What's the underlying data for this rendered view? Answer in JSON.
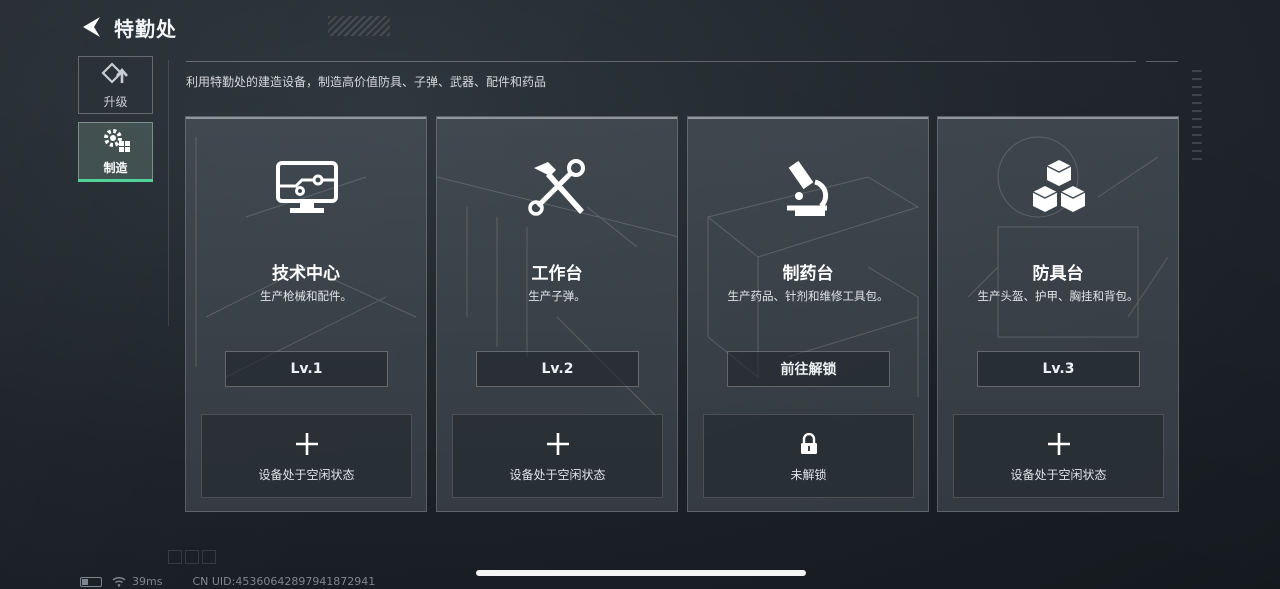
{
  "header": {
    "title": "特勤处"
  },
  "subtitle": "利用特勤处的建造设备，制造高价值防具、子弹、武器、配件和药品",
  "sidebar": {
    "tabs": [
      {
        "label": "升级",
        "icon": "upgrade-icon"
      },
      {
        "label": "制造",
        "icon": "gears-icon",
        "active": true
      }
    ]
  },
  "cards": [
    {
      "name": "技术中心",
      "desc": "生产枪械和配件。",
      "button": "Lv.1",
      "slot": "设备处于空闲状态",
      "icon": "monitor-circuit-icon",
      "slot_icon": "plus-icon"
    },
    {
      "name": "工作台",
      "desc": "生产子弹。",
      "button": "Lv.2",
      "slot": "设备处于空闲状态",
      "icon": "hammer-wrench-icon",
      "slot_icon": "plus-icon"
    },
    {
      "name": "制药台",
      "desc": "生产药品、针剂和维修工具包。",
      "button": "前往解锁",
      "slot": "未解锁",
      "icon": "microscope-icon",
      "slot_icon": "lock-icon"
    },
    {
      "name": "防具台",
      "desc": "生产头盔、护甲、胸挂和背包。",
      "button": "Lv.3",
      "slot": "设备处于空闲状态",
      "icon": "cubes-icon",
      "slot_icon": "plus-icon"
    }
  ],
  "status": {
    "ping": "39ms",
    "uid": "CN UID:453606428979418729​41"
  },
  "colors": {
    "accent": "#52d39a",
    "active_tab_bg": "#5f786e",
    "card_bg": "#464e56"
  }
}
